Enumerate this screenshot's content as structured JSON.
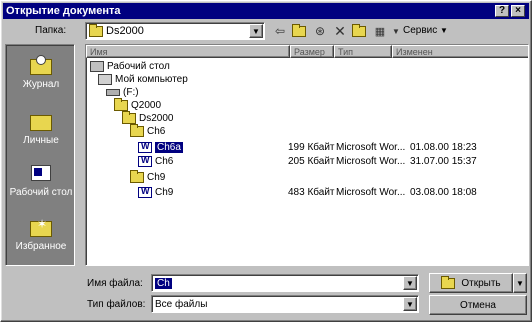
{
  "window": {
    "title": "Открытие документа",
    "help_btn": "?",
    "close_btn": "×"
  },
  "toolbar": {
    "folder_label": "Папка:",
    "folder_value": "Ds2000",
    "service_label": "Сервис"
  },
  "places": [
    {
      "label": "Журнал"
    },
    {
      "label": "Личные"
    },
    {
      "label": "Рабочий стол"
    },
    {
      "label": "Избранное"
    }
  ],
  "columns": {
    "name": "Имя",
    "size": "Размер",
    "type": "Тип",
    "modified": "Изменен"
  },
  "tree": [
    {
      "label": "Рабочий стол",
      "icon": "desktop-icon"
    },
    {
      "label": "Мой компьютер",
      "icon": "computer-icon"
    },
    {
      "label": "(F:)",
      "icon": "drive-icon"
    },
    {
      "label": "Q2000",
      "icon": "folder-icon"
    },
    {
      "label": "Ds2000",
      "icon": "folder-open-icon"
    },
    {
      "label": "Ch6",
      "icon": "folder-icon"
    },
    {
      "label": "Ch6a",
      "icon": "word-doc-icon",
      "size": "199 Кбайт",
      "type": "Microsoft Wor...",
      "modified": "01.08.00 18:23",
      "selected": true
    },
    {
      "label": "Ch6",
      "icon": "word-doc-icon",
      "size": "205 Кбайт",
      "type": "Microsoft Wor...",
      "modified": "31.07.00 15:37"
    },
    {
      "label": "Ch9",
      "icon": "folder-icon"
    },
    {
      "label": "Ch9",
      "icon": "word-doc-icon",
      "size": "483 Кбайт",
      "type": "Microsoft Wor...",
      "modified": "03.08.00 18:08"
    }
  ],
  "bottom": {
    "filename_label": "Имя файла:",
    "filename_value": "Ch",
    "filetype_label": "Тип файлов:",
    "filetype_value": "Все файлы",
    "open_label": "Открыть",
    "cancel_label": "Отмена"
  }
}
